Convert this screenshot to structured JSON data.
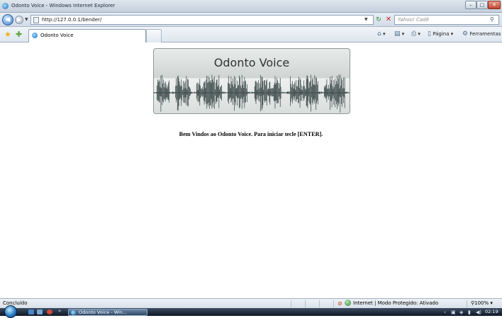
{
  "window": {
    "title": "Odonto Voice - Windows Internet Explorer"
  },
  "address_bar": {
    "url": "http://127.0.0.1/bender/"
  },
  "search": {
    "placeholder": "Yahoo! Cadê"
  },
  "tabs": [
    {
      "label": "Odonto Voice"
    }
  ],
  "command_bar": {
    "page_label": "Página",
    "tools_label": "Ferramentas"
  },
  "page": {
    "banner_title": "Odonto Voice",
    "welcome_text": "Bem Vindos ao Odonto Voice. Para iniciar tecle [ENTER]."
  },
  "status_bar": {
    "status": "Concluído",
    "zone": "Internet | Modo Protegido: Ativado",
    "zoom": "100%"
  },
  "taskbar": {
    "task_label": "Odonto Voice - Win...",
    "clock": "02:19"
  },
  "colors": {
    "waveform": "#2f3e3d",
    "banner_bg": "#d5dad8",
    "chrome": "#d2dce8"
  }
}
